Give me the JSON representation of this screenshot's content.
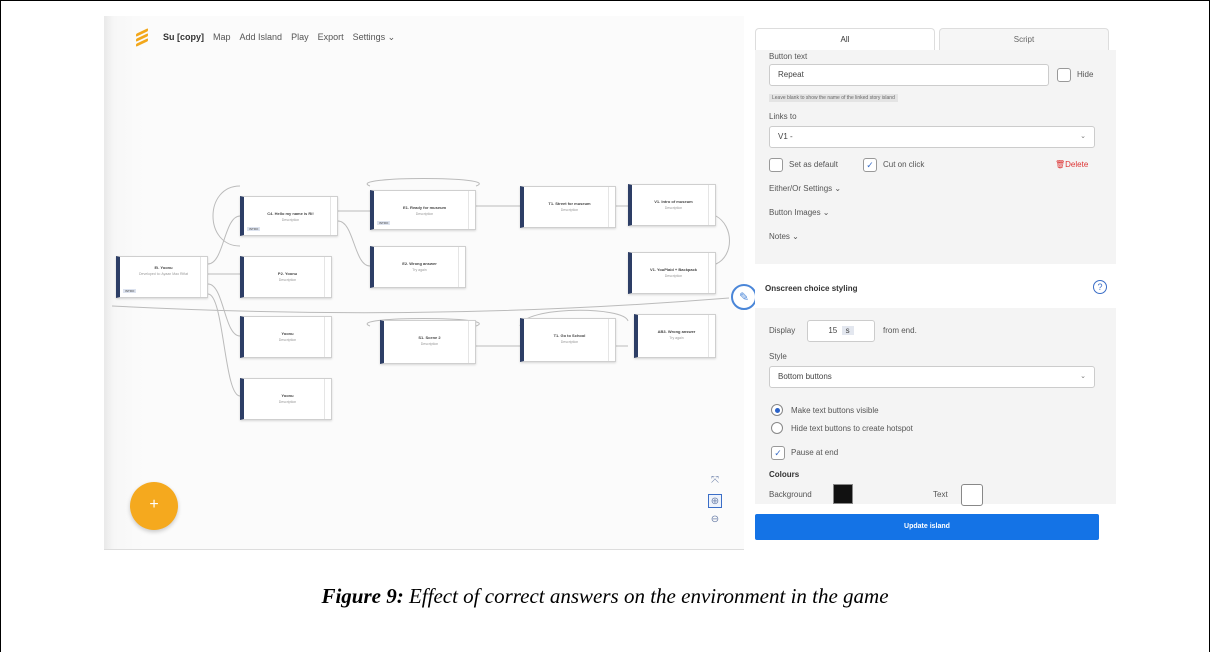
{
  "app": {
    "project": "Su [copy]",
    "nav": [
      "Map",
      "Add Island",
      "Play",
      "Export",
      "Settings ⌄"
    ]
  },
  "nodes": [
    {
      "id": "n0",
      "title": "Ei. Yoonu",
      "desc": "Developed to: Ayaan Mao Rifiat",
      "tag": "INTRO"
    },
    {
      "id": "n1",
      "title": "C4. Hello my name is Ri!",
      "desc": "Description",
      "tag": "INTRO"
    },
    {
      "id": "n2",
      "title": "E1. Ready for museum",
      "desc": "Description",
      "tag": "INTRO"
    },
    {
      "id": "n3",
      "title": "T1. Street for museum",
      "desc": "Description",
      "tag": ""
    },
    {
      "id": "n4",
      "title": "V1. Intro of museum",
      "desc": "Description",
      "tag": ""
    },
    {
      "id": "n5",
      "title": "E2. Wrong answer",
      "desc": "Try again",
      "tag": ""
    },
    {
      "id": "n6",
      "title": "V1. YouPlaid + Backpack",
      "desc": "Description",
      "tag": ""
    },
    {
      "id": "n7",
      "title": "P2. Yoonu",
      "desc": "Description",
      "tag": ""
    },
    {
      "id": "n8",
      "title": "S1. Scene 2",
      "desc": "Description",
      "tag": ""
    },
    {
      "id": "n9",
      "title": "T1. Go to School",
      "desc": "Description",
      "tag": ""
    },
    {
      "id": "n10",
      "title": "AB3. Wrong answer",
      "desc": "Try again",
      "tag": ""
    },
    {
      "id": "n11",
      "title": "Yoonu",
      "desc": "Description",
      "tag": ""
    },
    {
      "id": "n12",
      "title": "Yoonu",
      "desc": "Description",
      "tag": ""
    }
  ],
  "panel": {
    "tabs": [
      "All",
      "Script"
    ],
    "button_text_label": "Button text",
    "button_text_value": "Repeat",
    "hide_label": "Hide",
    "hint": "Leave blank to show the name of the linked story island",
    "links_to_label": "Links to",
    "links_to_value": "V1 -",
    "set_default": "Set as default",
    "cut_on_click": "Cut on click",
    "delete": "Delete",
    "either_or": "Either/Or Settings ⌄",
    "button_images": "Button Images ⌄",
    "notes": "Notes ⌄",
    "onscreen_title": "Onscreen choice styling",
    "display_label": "Display",
    "display_value": "15",
    "display_unit": "s",
    "from_end": "from end.",
    "style_label": "Style",
    "style_value": "Bottom buttons",
    "radio1": "Make text buttons visible",
    "radio2": "Hide text buttons to create hotspot",
    "pause_label": "Pause at end",
    "colours_label": "Colours",
    "background_label": "Background",
    "background_color": "#111111",
    "text_label": "Text",
    "text_color": "#ffffff",
    "update_button": "Update island"
  },
  "caption": {
    "figure": "Figure 9:",
    "text": " Effect of correct answers on the environment in the game"
  }
}
